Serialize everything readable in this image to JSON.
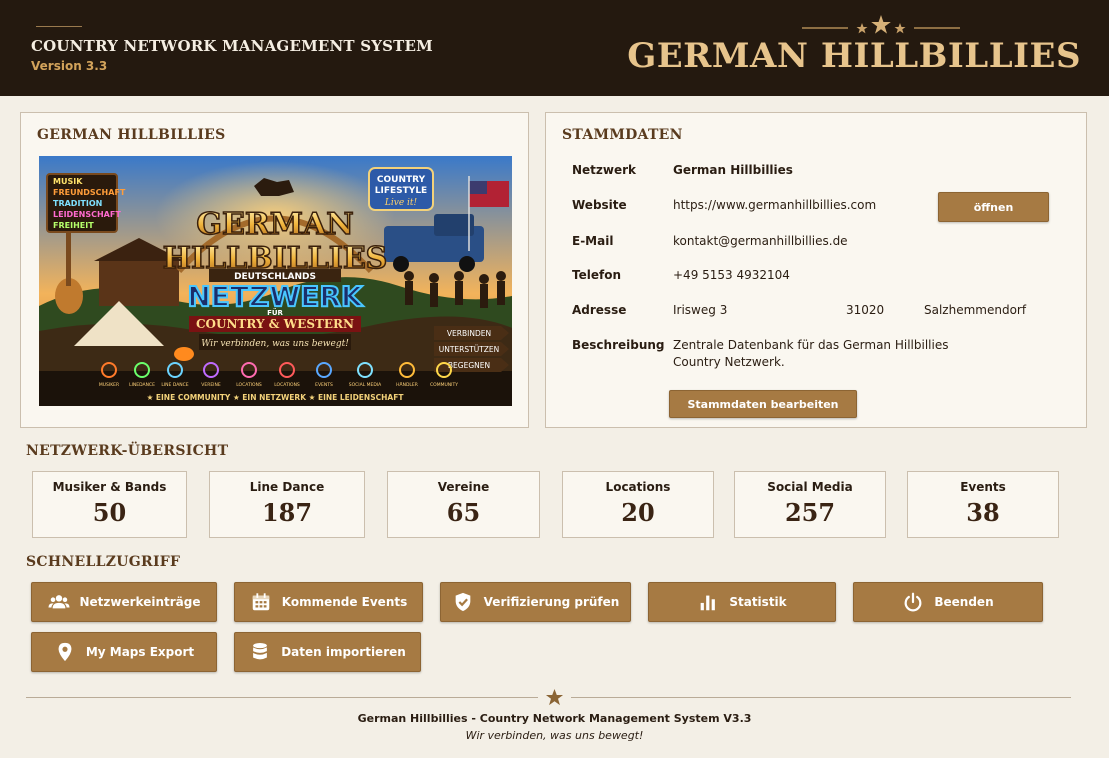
{
  "header": {
    "title": "COUNTRY NETWORK MANAGEMENT SYSTEM",
    "version": "Version 3.3",
    "brand": "GERMAN HILLBILLIES"
  },
  "banner_panel": {
    "title": "GERMAN HILLBILLIES",
    "sign_list": [
      "MUSIK",
      "FREUNDSCHAFT",
      "TRADITION",
      "LEIDENSCHAFT",
      "FREIHEIT"
    ],
    "bubble_line1": "COUNTRY",
    "bubble_line2": "LIFESTYLE",
    "bubble_line3": "Live it!",
    "logo_line1": "GERMAN",
    "logo_line2": "HILLBILLIES",
    "logo_sub": "DEUTSCHLANDS",
    "logo_main": "NETZWERK",
    "logo_fur": "FÜR",
    "logo_country": "COUNTRY & WESTERN",
    "slogan": "Wir verbinden, was uns bewegt!",
    "arrows": [
      "VERBINDEN",
      "UNTERSTÜTZEN",
      "BEGEGNEN"
    ],
    "icon_labels": [
      "MUSIKER",
      "LINEDANCE",
      "LINE DANCE",
      "VEREINE",
      "LOCATIONS",
      "LOCATIONS",
      "EVENTS",
      "SOCIAL MEDIA",
      "HÄNDLER",
      "COMMUNITY"
    ],
    "bottom_text": "★ EINE COMMUNITY  ★ EIN NETZWERK  ★ EINE LEIDENSCHAFT"
  },
  "stammdaten": {
    "title": "STAMMDATEN",
    "netzwerk_label": "Netzwerk",
    "netzwerk_value": "German Hillbillies",
    "website_label": "Website",
    "website_value": "https://www.germanhillbillies.com",
    "open_button": "öffnen",
    "email_label": "E-Mail",
    "email_value": "kontakt@germanhillbillies.de",
    "telefon_label": "Telefon",
    "telefon_value": "+49 5153 4932104",
    "adresse_label": "Adresse",
    "street": "Irisweg 3",
    "zip": "31020",
    "city": "Salzhemmendorf",
    "beschreibung_label": "Beschreibung",
    "beschreibung_line1": "Zentrale Datenbank für das German Hillbillies",
    "beschreibung_line2": "Country Netzwerk.",
    "edit_button": "Stammdaten bearbeiten"
  },
  "overview": {
    "title": "NETZWERK-ÜBERSICHT",
    "stats": [
      {
        "label": "Musiker & Bands",
        "value": "50"
      },
      {
        "label": "Line Dance",
        "value": "187"
      },
      {
        "label": "Vereine",
        "value": "65"
      },
      {
        "label": "Locations",
        "value": "20"
      },
      {
        "label": "Social Media",
        "value": "257"
      },
      {
        "label": "Events",
        "value": "38"
      }
    ]
  },
  "quick": {
    "title": "SCHNELLZUGRIFF",
    "buttons": [
      {
        "label": "Netzwerkeinträge",
        "icon": "users-icon"
      },
      {
        "label": "Kommende Events",
        "icon": "calendar-icon"
      },
      {
        "label": "Verifizierung prüfen",
        "icon": "shield-check-icon"
      },
      {
        "label": "Statistik",
        "icon": "bar-chart-icon"
      },
      {
        "label": "Beenden",
        "icon": "power-icon"
      },
      {
        "label": "My Maps Export",
        "icon": "map-pin-icon"
      },
      {
        "label": "Daten importieren",
        "icon": "database-icon"
      }
    ]
  },
  "footer": {
    "line1": "German Hillbillies - Country Network Management System V3.3",
    "line2": "Wir verbinden, was uns bewegt!"
  },
  "colors": {
    "header_bg": "#24190f",
    "accent": "#a67a43",
    "brand_gold": "#e7c48c",
    "page_bg": "#f3efe6"
  }
}
